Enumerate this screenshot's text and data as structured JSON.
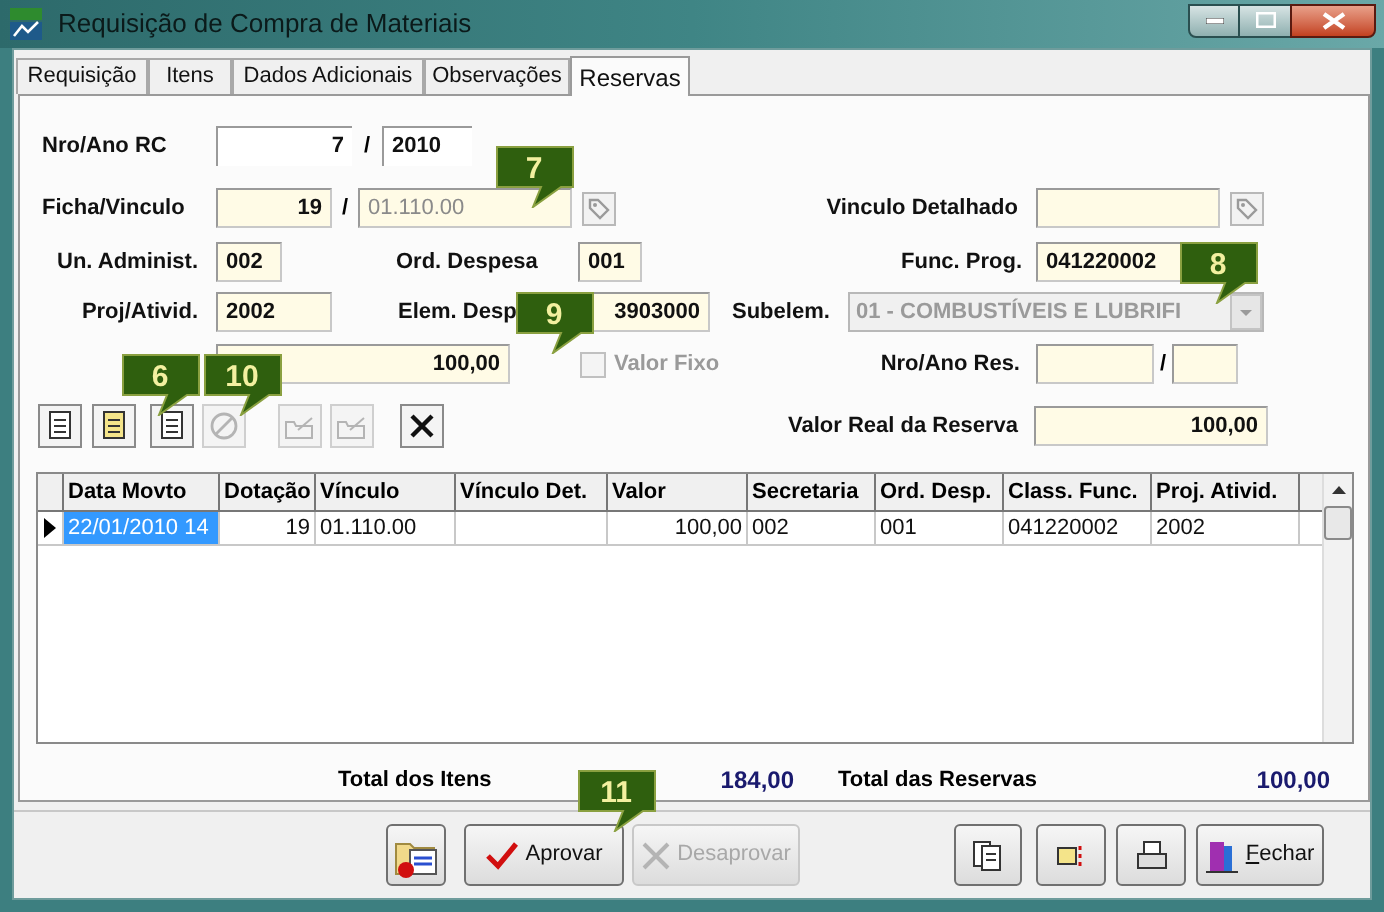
{
  "window": {
    "title": "Requisição de Compra de Materiais"
  },
  "tabs": [
    {
      "label": "Requisição",
      "selected": false
    },
    {
      "label": "Itens",
      "selected": false
    },
    {
      "label": "Dados Adicionais",
      "selected": false
    },
    {
      "label": "Observações",
      "selected": false
    },
    {
      "label": "Reservas",
      "selected": true
    }
  ],
  "form": {
    "nro_ano_rc": {
      "label": "Nro/Ano RC",
      "number": "7",
      "separator": "/",
      "year": "2010",
      "readonly": true
    },
    "ficha_vinculo": {
      "label": "Ficha/Vinculo",
      "ficha": "19",
      "separator": "/",
      "vinculo": "01.110.00",
      "vinculo_disabled": true
    },
    "vinculo_detalhado": {
      "label": "Vinculo Detalhado"
    },
    "un_administ": {
      "label": "Un. Administ.",
      "value": "002"
    },
    "ord_despesa": {
      "label": "Ord. Despesa",
      "value": "001"
    },
    "func_prog": {
      "label": "Func. Prog.",
      "value": "041220002"
    },
    "proj_ativid": {
      "label": "Proj/Ativid.",
      "value": "2002"
    },
    "elem_desp": {
      "label": "Elem. Desp",
      "value": "3903000"
    },
    "subelem": {
      "label": "Subelem.",
      "value": "01 - COMBUSTÍVEIS E LUBRIFI",
      "disabled": true
    },
    "valor": {
      "value": "100,00"
    },
    "valor_fixo": {
      "label": "Valor Fixo",
      "checked": false,
      "disabled": true
    },
    "nro_ano_res": {
      "label": "Nro/Ano Res.",
      "separator": "/"
    },
    "valor_real": {
      "label": "Valor Real da Reserva",
      "value": "100,00"
    }
  },
  "toolbar": [
    {
      "disabled": false
    },
    {
      "disabled": false
    },
    {
      "disabled": false
    },
    {
      "disabled": true
    },
    {
      "disabled": true
    },
    {
      "disabled": true
    },
    {
      "disabled": false
    }
  ],
  "table": {
    "columns": [
      "Data Movto",
      "Dotação",
      "Vínculo",
      "Vínculo Det.",
      "Valor",
      "Secretaria",
      "Ord. Desp.",
      "Class. Func.",
      "Proj. Ativid."
    ],
    "rows": [
      {
        "selected": true,
        "cells": [
          "22/01/2010 14",
          "19",
          "01.110.00",
          "",
          "100,00",
          "002",
          "001",
          "041220002",
          "2002"
        ]
      }
    ]
  },
  "totals": [
    {
      "label": "Total dos Itens",
      "value": "184,00"
    },
    {
      "label": "Total das Reservas",
      "value": "100,00"
    }
  ],
  "bottom_buttons": [
    {
      "kind": "icon",
      "disabled": false
    },
    {
      "kind": "text",
      "label": "Aprovar",
      "disabled": false
    },
    {
      "kind": "text",
      "label": "Desaprovar",
      "disabled": true
    },
    {
      "kind": "icon",
      "disabled": false
    },
    {
      "kind": "icon",
      "disabled": false
    },
    {
      "kind": "icon",
      "disabled": false
    },
    {
      "kind": "text",
      "label": "Fechar",
      "disabled": false
    }
  ],
  "callouts": [
    {
      "label": "7"
    },
    {
      "label": "8"
    },
    {
      "label": "9"
    },
    {
      "label": "6"
    },
    {
      "label": "10"
    },
    {
      "label": "11"
    }
  ]
}
